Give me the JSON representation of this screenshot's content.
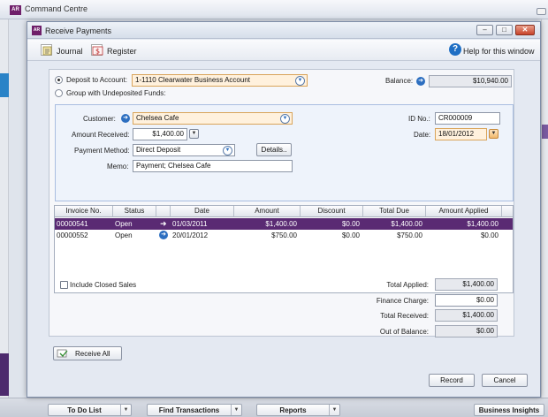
{
  "command_centre": {
    "title": "Command Centre",
    "logo_text": "AR",
    "bottom_buttons": [
      {
        "label": "To Do List"
      },
      {
        "label": "Find Transactions"
      },
      {
        "label": "Reports"
      },
      {
        "label": "Business Insights"
      }
    ]
  },
  "window": {
    "title": "Receive Payments",
    "logo_text": "AR",
    "controls": {
      "minimize": "–",
      "maximize": "□",
      "close": "✕"
    }
  },
  "toolbar": {
    "journal_label": "Journal",
    "register_label": "Register",
    "help_label": "Help for this window",
    "help_glyph": "?"
  },
  "deposit": {
    "deposit_to_account_label": "Deposit to Account:",
    "group_undeposited_label": "Group with Undeposited Funds:",
    "selected_option": "deposit_to_account",
    "account_value": "1-1110 Clearwater Business Account",
    "balance_label": "Balance:",
    "balance_value": "$10,940.00"
  },
  "payment": {
    "customer_label": "Customer:",
    "customer_value": "Chelsea Cafe",
    "id_label": "ID No.:",
    "id_value": "CR000009",
    "amount_label": "Amount Received:",
    "amount_value": "$1,400.00",
    "date_label": "Date:",
    "date_value": "18/01/2012",
    "method_label": "Payment Method:",
    "method_value": "Direct Deposit",
    "details_button": "Details..",
    "memo_label": "Memo:",
    "memo_value": "Payment; Chelsea Cafe"
  },
  "invoices": {
    "columns": [
      "Invoice No.",
      "Status",
      "Date",
      "Amount",
      "Discount",
      "Total Due",
      "Amount Applied"
    ],
    "rows": [
      {
        "invoice": "00000541",
        "status": "Open",
        "date": "01/03/2011",
        "amount": "$1,400.00",
        "discount": "$0.00",
        "total_due": "$1,400.00",
        "applied": "$1,400.00",
        "selected": true
      },
      {
        "invoice": "00000552",
        "status": "Open",
        "date": "20/01/2012",
        "amount": "$750.00",
        "discount": "$0.00",
        "total_due": "$750.00",
        "applied": "$0.00",
        "selected": false
      }
    ]
  },
  "options": {
    "include_closed_sales_label": "Include Closed Sales",
    "include_closed_sales_checked": false
  },
  "totals": {
    "total_applied_label": "Total Applied:",
    "total_applied_value": "$1,400.00",
    "finance_charge_label": "Finance Charge:",
    "finance_charge_value": "$0.00",
    "total_received_label": "Total Received:",
    "total_received_value": "$1,400.00",
    "out_of_balance_label": "Out of Balance:",
    "out_of_balance_value": "$0.00"
  },
  "actions": {
    "receive_all": "Receive All",
    "record": "Record",
    "cancel": "Cancel"
  },
  "colors": {
    "selection": "#5a2a73",
    "brand": "#6f1f6a",
    "accent_blue": "#2d6fc0",
    "highlight_field": "#fff1dd"
  }
}
